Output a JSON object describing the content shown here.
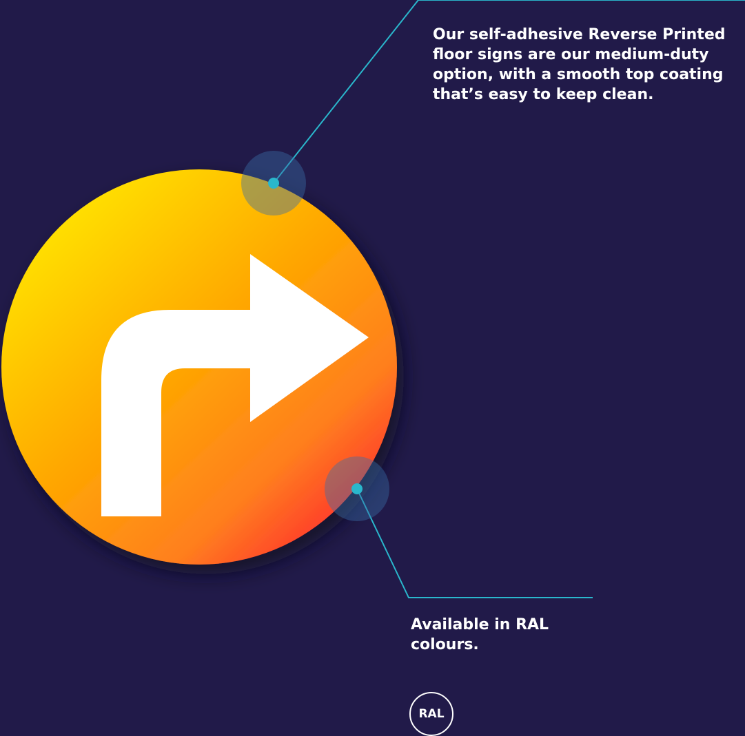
{
  "colors": {
    "background": "#211a49",
    "leader_line": "#2ab7cc",
    "text": "#ffffff",
    "arrow": "#ffffff",
    "disc_gradient": [
      "#ffe600",
      "#ffa800",
      "#ff3a2e"
    ]
  },
  "graphic": {
    "icon": "turn-right-arrow-icon"
  },
  "callouts": {
    "top": {
      "lines": [
        "Our self-adhesive Reverse Printed",
        "floor signs are our medium-duty",
        "option, with a smooth top coating",
        "that’s easy to keep clean."
      ]
    },
    "bottom": {
      "lines": [
        "Available in RAL",
        "colours."
      ]
    }
  },
  "badge": {
    "label": "RAL"
  }
}
